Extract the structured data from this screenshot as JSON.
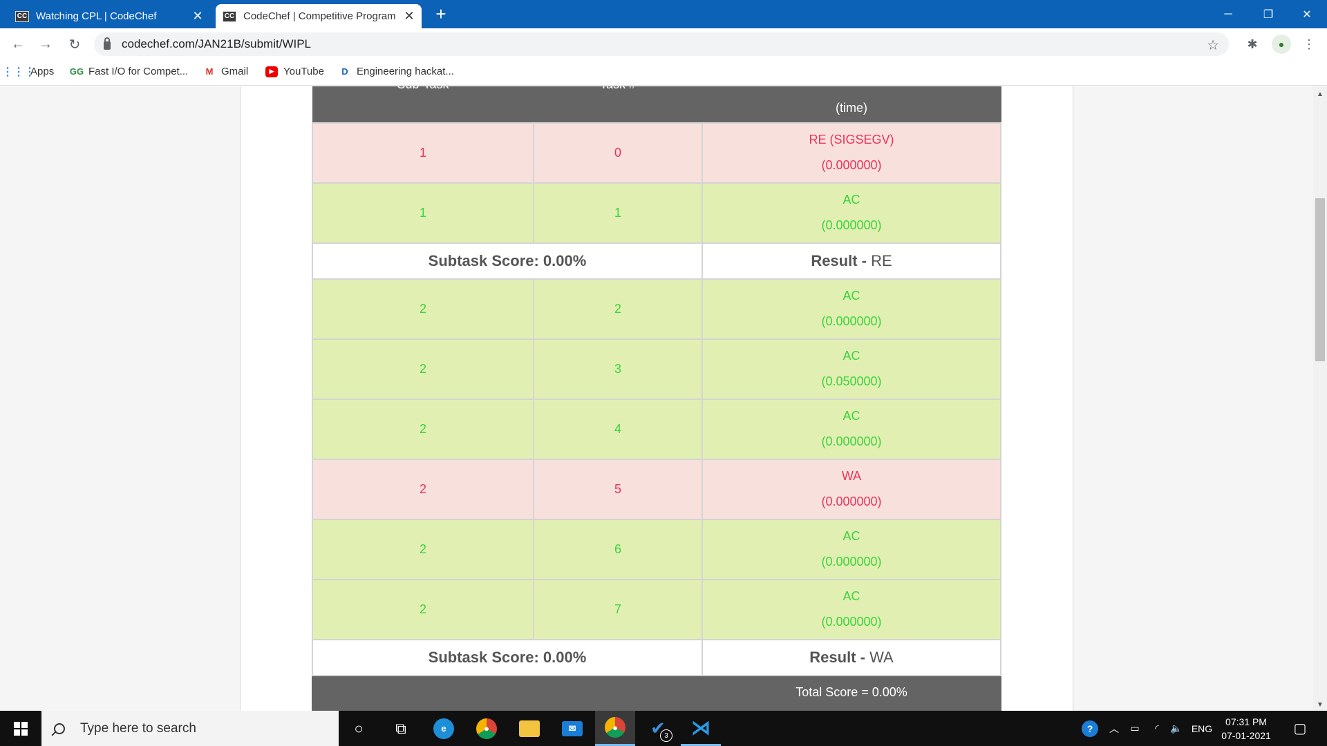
{
  "browser": {
    "tabs": [
      {
        "icon": "CC",
        "title": "Watching CPL | CodeChef",
        "active": false
      },
      {
        "icon": "CC",
        "title": "CodeChef | Competitive Program",
        "active": true
      }
    ],
    "url": "codechef.com/JAN21B/submit/WIPL",
    "bookmarks": [
      {
        "label": "Apps",
        "icon": "apps-grid-icon"
      },
      {
        "label": "Fast I/O for Compet...",
        "icon": "geeksforgeeks-icon"
      },
      {
        "label": "Gmail",
        "icon": "gmail-icon"
      },
      {
        "label": "YouTube",
        "icon": "youtube-icon"
      },
      {
        "label": "Engineering hackat...",
        "icon": "dare2compete-icon"
      }
    ]
  },
  "results_table": {
    "headers": {
      "subtask": "Sub-Task",
      "task": "Task #",
      "result": "(time)"
    },
    "groups": [
      {
        "rows": [
          {
            "subtask": "1",
            "task": "0",
            "verdict": "RE (SIGSEGV)",
            "time": "(0.000000)",
            "status": "re"
          },
          {
            "subtask": "1",
            "task": "1",
            "verdict": "AC",
            "time": "(0.000000)",
            "status": "ac"
          }
        ],
        "subtask_score_label": "Subtask Score: 0.00%",
        "result_label": "Result -",
        "result_value": "RE"
      },
      {
        "rows": [
          {
            "subtask": "2",
            "task": "2",
            "verdict": "AC",
            "time": "(0.000000)",
            "status": "ac"
          },
          {
            "subtask": "2",
            "task": "3",
            "verdict": "AC",
            "time": "(0.050000)",
            "status": "ac"
          },
          {
            "subtask": "2",
            "task": "4",
            "verdict": "AC",
            "time": "(0.000000)",
            "status": "ac"
          },
          {
            "subtask": "2",
            "task": "5",
            "verdict": "WA",
            "time": "(0.000000)",
            "status": "re"
          },
          {
            "subtask": "2",
            "task": "6",
            "verdict": "AC",
            "time": "(0.000000)",
            "status": "ac"
          },
          {
            "subtask": "2",
            "task": "7",
            "verdict": "AC",
            "time": "(0.000000)",
            "status": "ac"
          }
        ],
        "subtask_score_label": "Subtask Score: 0.00%",
        "result_label": "Result -",
        "result_value": "WA"
      }
    ],
    "total_score": "Total Score = 0.00%"
  },
  "colors": {
    "accepted_bg": "#e2efb3",
    "accepted_text": "#3ad43a",
    "error_bg": "#f8e0dd",
    "error_text": "#e8345a",
    "header_bg": "#646464",
    "titlebar": "#0b62b7"
  },
  "taskbar": {
    "search_placeholder": "Type here to search",
    "vscode_badge": "3",
    "language": "ENG",
    "time": "07:31 PM",
    "date": "07-01-2021"
  }
}
